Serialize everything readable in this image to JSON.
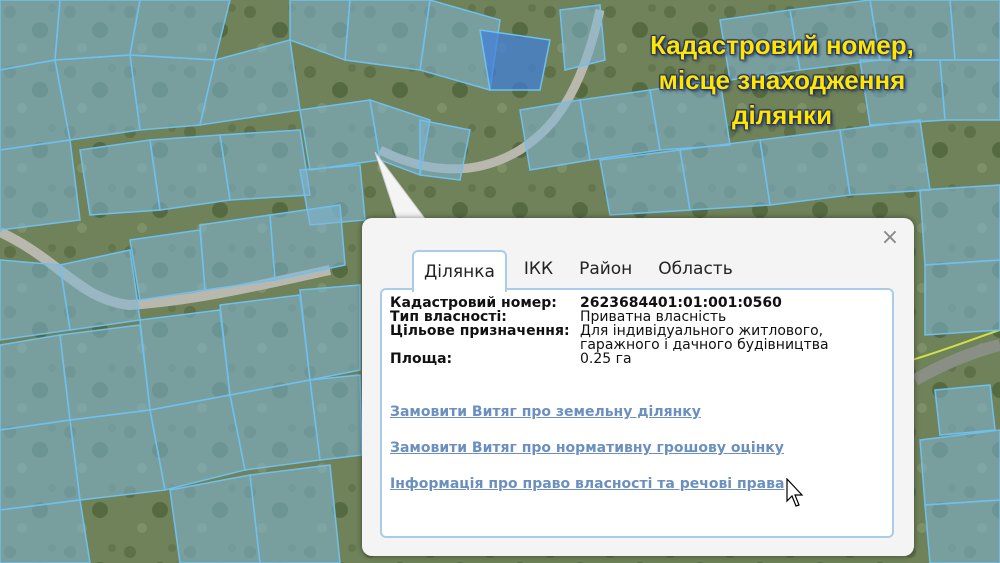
{
  "caption": {
    "line1": "Кадастровий номер,",
    "line2": "місце знаходження",
    "line3": "ділянки"
  },
  "popup": {
    "close_label": "×",
    "tabs": [
      {
        "label": "Ділянка",
        "active": true
      },
      {
        "label": "ІКК",
        "active": false
      },
      {
        "label": "Район",
        "active": false
      },
      {
        "label": "Область",
        "active": false
      }
    ],
    "fields": {
      "cadastral_label": "Кадастровий номер:",
      "cadastral_value": "2623684401:01:001:0560",
      "ownership_label": "Тип власності:",
      "ownership_value": "Приватна власність",
      "purpose_label": "Цільове призначення:",
      "purpose_value_line1": "Для індивідуального житлового,",
      "purpose_value_line2": "гаражного і дачного будівництва",
      "area_label": "Площа:",
      "area_value": "0.25 га"
    },
    "links": {
      "extract_land": "Замовити Витяг про земельну ділянку",
      "extract_valuation": "Замовити Витяг про нормативну грошову оцінку",
      "ownership_info": "Інформація про право власності та речові права"
    }
  },
  "colors": {
    "parcel_fill": "#7fb6d6",
    "parcel_stroke": "#6fc0ee",
    "caption_text": "#ffe600",
    "link": "#6b8fbf",
    "tab_border": "#a7cde8"
  }
}
